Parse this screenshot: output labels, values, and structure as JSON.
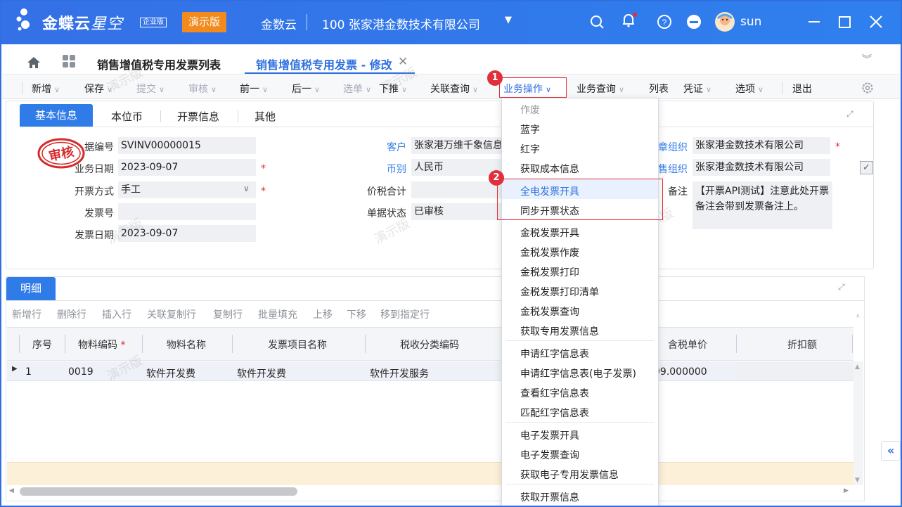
{
  "title_bar": {
    "brand": "金蝶云",
    "brand_sub": "星空",
    "edition": "企业版",
    "demo_badge": "演示版",
    "product": "金数云",
    "org": "100  张家港金数技术有限公司",
    "user": "sun"
  },
  "tabs": {
    "list_tab": "销售增值税专用发票列表",
    "active_tab": "销售增值税专用发票 - 修改"
  },
  "toolbar": {
    "new": "新增",
    "save": "保存",
    "submit": "提交",
    "audit": "审核",
    "prev": "前一",
    "next": "后一",
    "select": "选单",
    "push": "下推",
    "related_query": "关联查询",
    "biz_ops": "业务操作",
    "biz_query": "业务查询",
    "list": "列表",
    "voucher": "凭证",
    "options": "选项",
    "exit": "退出"
  },
  "badges": {
    "step1": "1",
    "step2": "2"
  },
  "basic_tabs": [
    "基本信息",
    "本位币",
    "开票信息",
    "其他"
  ],
  "stamp_text": "审核",
  "form": {
    "doc_no_label": "据编号",
    "doc_no": "SVINV00000015",
    "biz_date_label": "业务日期",
    "biz_date": "2023-09-07",
    "invoice_method_label": "开票方式",
    "invoice_method": "手工",
    "invoice_no_label": "发票号",
    "invoice_no": "",
    "invoice_date_label": "发票日期",
    "invoice_date": "2023-09-07",
    "customer_label": "客户",
    "customer": "张家港万维千象信息",
    "currency_label": "币别",
    "currency": "人民币",
    "total_label": "价税合计",
    "total": "",
    "status_label": "单据状态",
    "status": "已审核",
    "settle_org_label": "章组织",
    "settle_org": "张家港金数技术有限公司",
    "sales_org_label": "售组织",
    "sales_org": "张家港金数技术有限公司",
    "remark_label": "备注",
    "remark": "【开票API测试】注意此处开票备注会带到发票备注上。"
  },
  "detail": {
    "tab": "明细",
    "buttons": [
      "新增行",
      "删除行",
      "插入行",
      "关联复制行",
      "复制行",
      "批量填充",
      "上移",
      "下移",
      "移到指定行"
    ],
    "columns": [
      "序号",
      "物料编码",
      "物料名称",
      "发票项目名称",
      "税收分类编码",
      "含税单价",
      "折扣额"
    ],
    "row": {
      "seq": "1",
      "code": "0019",
      "name": "软件开发费",
      "item": "软件开发费",
      "tax_class": "软件开发服务",
      "price": "99.000000"
    }
  },
  "menu": {
    "items": [
      "作废",
      "蓝字",
      "红字",
      "获取成本信息",
      "全电发票开具",
      "同步开票状态",
      "金税发票开具",
      "金税发票作废",
      "金税发票打印",
      "金税发票打印清单",
      "金税发票查询",
      "获取专用发票信息",
      "申请红字信息表",
      "申请红字信息表(电子发票)",
      "查看红字信息表",
      "匹配红字信息表",
      "电子发票开具",
      "电子发票查询",
      "获取电子专用发票信息",
      "获取开票信息"
    ]
  },
  "watermark": "演示版"
}
